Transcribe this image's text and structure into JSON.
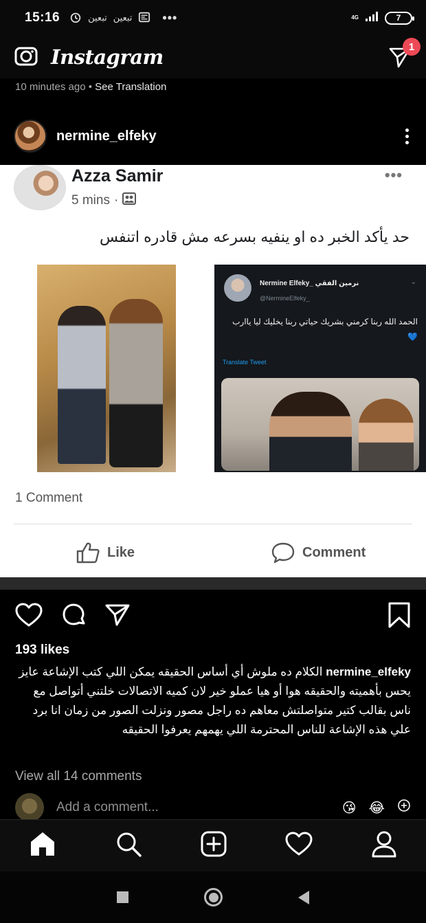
{
  "status_bar": {
    "time": "15:16",
    "notif_labels": [
      "تبعين",
      "تبعين"
    ],
    "dots": "•••",
    "network": "4G",
    "battery": "7"
  },
  "header": {
    "app_name": "Instagram",
    "dm_badge": "1"
  },
  "post_meta": {
    "time_ago": "10 minutes ago",
    "separator": " • ",
    "see_translation": "See Translation"
  },
  "post": {
    "username": "nermine_elfeky"
  },
  "fb_card": {
    "author": "Azza Samir",
    "time": "5 mins",
    "separator": "·",
    "text": "حد يأكد الخبر ده او ينفيه بسرعه مش قادره اتنفس",
    "tweet": {
      "name": "Nermine Elfeky_ نرمين الفقي",
      "handle": "@NermineElfeky_",
      "text": "الحمد الله ربنا كرمني بشريك حياتي ربنا يخليك ليا ياارب 💙",
      "translate": "Translate Tweet"
    },
    "comments_count": "1 Comment",
    "like_label": "Like",
    "comment_label": "Comment"
  },
  "actions": {
    "likes": "193 likes"
  },
  "caption": {
    "username": "nermine_elfeky",
    "text": "الكلام ده ملوش أي أساس الحقيقه يمكن اللي كتب الإشاعة عايز يحس بأهميته والحقيقه هوا أو هيا عملو خير لان كميه الاتصالات خلتني أتواصل مع ناس بقالب كتير متواصلتش معاهم ده راجل مصور ونزلت الصور من زمان انا برد علي هذه الإشاعة للناس المحترمة اللي يهمهم يعرفوا الحقيقه"
  },
  "comments": {
    "view_all": "View all 14 comments",
    "add_placeholder": "Add a comment...",
    "emojis": [
      "😘",
      "😂"
    ]
  },
  "colors": {
    "badge": "#ed4956",
    "twitter_blue": "#1d9bf0"
  }
}
